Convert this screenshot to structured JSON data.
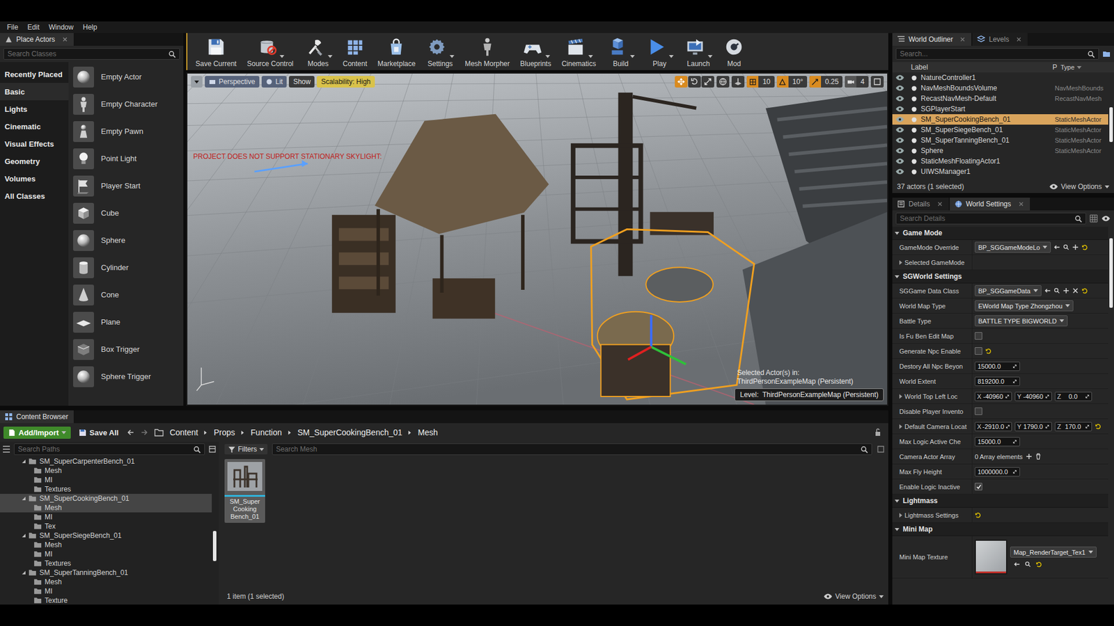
{
  "menu": [
    "File",
    "Edit",
    "Window",
    "Help"
  ],
  "place_actors": {
    "title": "Place Actors",
    "search_placeholder": "Search Classes",
    "categories": [
      {
        "label": "Recently Placed",
        "selected": false
      },
      {
        "label": "Basic",
        "selected": true
      },
      {
        "label": "Lights",
        "selected": false
      },
      {
        "label": "Cinematic",
        "selected": false
      },
      {
        "label": "Visual Effects",
        "selected": false
      },
      {
        "label": "Geometry",
        "selected": false
      },
      {
        "label": "Volumes",
        "selected": false
      },
      {
        "label": "All Classes",
        "selected": false
      }
    ],
    "items": [
      "Empty Actor",
      "Empty Character",
      "Empty Pawn",
      "Point Light",
      "Player Start",
      "Cube",
      "Sphere",
      "Cylinder",
      "Cone",
      "Plane",
      "Box Trigger",
      "Sphere Trigger"
    ]
  },
  "toolbar": [
    {
      "label": "Save Current",
      "dropdown": false
    },
    {
      "label": "Source Control",
      "dropdown": true
    },
    {
      "label": "Modes",
      "dropdown": true
    },
    {
      "label": "Content",
      "dropdown": false
    },
    {
      "label": "Marketplace",
      "dropdown": false
    },
    {
      "label": "Settings",
      "dropdown": true
    },
    {
      "label": "Mesh Morpher",
      "dropdown": false
    },
    {
      "label": "Blueprints",
      "dropdown": true
    },
    {
      "label": "Cinematics",
      "dropdown": true
    },
    {
      "label": "Build",
      "dropdown": true
    },
    {
      "label": "Play",
      "dropdown": true
    },
    {
      "label": "Launch",
      "dropdown": true
    },
    {
      "label": "Mod",
      "dropdown": false
    }
  ],
  "viewport": {
    "view_mode": "Perspective",
    "lighting": "Lit",
    "show": "Show",
    "scalability": "Scalability: High",
    "warning": "PROJECT DOES NOT SUPPORT STATIONARY SKYLIGHT:",
    "snaps": [
      {
        "value": "10",
        "on": true
      },
      {
        "value": "10°",
        "on": true
      },
      {
        "value": "0.25",
        "on": true
      }
    ],
    "camera_speed": "4",
    "selection_info": [
      "Selected Actor(s) in:",
      "ThirdPersonExampleMap (Persistent)"
    ],
    "level_label": "Level:  ThirdPersonExampleMap (Persistent)"
  },
  "world_outliner": {
    "tabs": [
      {
        "label": "World Outliner",
        "selected": true
      },
      {
        "label": "Levels",
        "selected": false
      }
    ],
    "search_placeholder": "Search...",
    "columns": [
      "Label",
      "P",
      "Type"
    ],
    "rows": [
      {
        "label": "NatureController1",
        "type": "",
        "selected": false
      },
      {
        "label": "NavMeshBoundsVolume",
        "type": "NavMeshBounds",
        "selected": false
      },
      {
        "label": "RecastNavMesh-Default",
        "type": "RecastNavMesh",
        "selected": false
      },
      {
        "label": "SGPlayerStart",
        "type": "",
        "selected": false
      },
      {
        "label": "SM_SuperCookingBench_01",
        "type": "StaticMeshActor",
        "selected": true
      },
      {
        "label": "SM_SuperSiegeBench_01",
        "type": "StaticMeshActor",
        "selected": false
      },
      {
        "label": "SM_SuperTanningBench_01",
        "type": "StaticMeshActor",
        "selected": false
      },
      {
        "label": "Sphere",
        "type": "StaticMeshActor",
        "selected": false
      },
      {
        "label": "StaticMeshFloatingActor1",
        "type": "",
        "selected": false
      },
      {
        "label": "UIWSManager1",
        "type": "",
        "selected": false
      }
    ],
    "summary": "37 actors (1 selected)",
    "view_options": "View Options"
  },
  "details": {
    "tabs": [
      {
        "label": "Details",
        "selected": false
      },
      {
        "label": "World Settings",
        "selected": true
      }
    ],
    "search_placeholder": "Search Details",
    "sections": [
      {
        "title": "Game Mode",
        "expanded": true,
        "rows": [
          {
            "kind": "object",
            "label": "GameMode Override",
            "value": "BP_SGGameModeLo",
            "modified": true,
            "clearable": false
          },
          {
            "kind": "group",
            "label": "Selected GameMode",
            "expanded": false,
            "modified": false
          }
        ]
      },
      {
        "title": "SGWorld Settings",
        "expanded": true,
        "rows": [
          {
            "kind": "object",
            "label": "SGGame Data Class",
            "value": "BP_SGGameData",
            "modified": true,
            "clearable": true
          },
          {
            "kind": "enum",
            "label": "World Map Type",
            "value": "EWorld Map Type Zhongzhou",
            "modified": false
          },
          {
            "kind": "enum",
            "label": "Battle Type",
            "value": "BATTLE TYPE BIGWORLD",
            "modified": false
          },
          {
            "kind": "checkbox",
            "label": "Is Fu Ben Edit Map",
            "checked": false,
            "modified": false
          },
          {
            "kind": "checkbox",
            "label": "Generate Npc Enable",
            "checked": false,
            "modified": true
          },
          {
            "kind": "number",
            "label": "Destory All Npc Beyon",
            "value": "15000.0",
            "modified": false
          },
          {
            "kind": "number",
            "label": "World Extent",
            "value": "819200.0",
            "modified": false
          },
          {
            "kind": "vector",
            "label": "World Top Left Loc",
            "expanded": false,
            "components": [
              {
                "axis": "X",
                "value": "-40960"
              },
              {
                "axis": "Y",
                "value": "-40960"
              },
              {
                "axis": "Z",
                "value": "0.0"
              }
            ],
            "modified": false
          },
          {
            "kind": "checkbox",
            "label": "Disable Player Invento",
            "checked": false,
            "modified": false
          },
          {
            "kind": "vector",
            "label": "Default Camera Locat",
            "expanded": false,
            "components": [
              {
                "axis": "X",
                "value": "-2910.0"
              },
              {
                "axis": "Y",
                "value": "1790.0"
              },
              {
                "axis": "Z",
                "value": "170.0"
              }
            ],
            "modified": true
          },
          {
            "kind": "number",
            "label": "Max Logic Active Che",
            "value": "15000.0",
            "modified": false
          },
          {
            "kind": "array",
            "label": "Camera Actor Array",
            "value": "0 Array elements",
            "modified": false
          },
          {
            "kind": "number",
            "label": "Max Fly Height",
            "value": "1000000.0",
            "modified": false
          },
          {
            "kind": "checkbox",
            "label": "Enable Logic Inactive",
            "checked": true,
            "modified": false
          }
        ]
      },
      {
        "title": "Lightmass",
        "expanded": true,
        "rows": [
          {
            "kind": "group",
            "label": "Lightmass Settings",
            "expanded": false,
            "modified": true
          }
        ]
      },
      {
        "title": "Mini Map",
        "expanded": true,
        "rows": [
          {
            "kind": "texture",
            "label": "Mini Map Texture",
            "value": "Map_RenderTarget_Tex1",
            "modified": true
          }
        ]
      }
    ]
  },
  "content_browser": {
    "title": "Content Browser",
    "add_button": "Add/Import",
    "save_button": "Save All",
    "breadcrumb": [
      "Content",
      "Props",
      "Function",
      "SM_SuperCookingBench_01",
      "Mesh"
    ],
    "paths_placeholder": "Search Paths",
    "filters": "Filters",
    "search_placeholder": "Search Mesh",
    "tree": [
      {
        "label": "SM_SuperCarpenterBench_01",
        "depth": 0,
        "expanded": true,
        "selected": false
      },
      {
        "label": "Mesh",
        "depth": 1,
        "expanded": false,
        "selected": false
      },
      {
        "label": "MI",
        "depth": 1,
        "expanded": false,
        "selected": false
      },
      {
        "label": "Textures",
        "depth": 1,
        "expanded": false,
        "selected": false
      },
      {
        "label": "SM_SuperCookingBench_01",
        "depth": 0,
        "expanded": true,
        "selected": true
      },
      {
        "label": "Mesh",
        "depth": 1,
        "expanded": false,
        "selected": true
      },
      {
        "label": "MI",
        "depth": 1,
        "expanded": false,
        "selected": false
      },
      {
        "label": "Tex",
        "depth": 1,
        "expanded": false,
        "selected": false
      },
      {
        "label": "SM_SuperSiegeBench_01",
        "depth": 0,
        "expanded": true,
        "selected": false
      },
      {
        "label": "Mesh",
        "depth": 1,
        "expanded": false,
        "selected": false
      },
      {
        "label": "MI",
        "depth": 1,
        "expanded": false,
        "selected": false
      },
      {
        "label": "Textures",
        "depth": 1,
        "expanded": false,
        "selected": false
      },
      {
        "label": "SM_SuperTanningBench_01",
        "depth": 0,
        "expanded": true,
        "selected": false
      },
      {
        "label": "Mesh",
        "depth": 1,
        "expanded": false,
        "selected": false
      },
      {
        "label": "MI",
        "depth": 1,
        "expanded": false,
        "selected": false
      },
      {
        "label": "Texture",
        "depth": 1,
        "expanded": false,
        "selected": false
      }
    ],
    "assets": [
      {
        "label": "SM_Super Cooking Bench_01",
        "selected": true
      }
    ],
    "status": "1 item (1 selected)",
    "view_options": "View Options"
  }
}
